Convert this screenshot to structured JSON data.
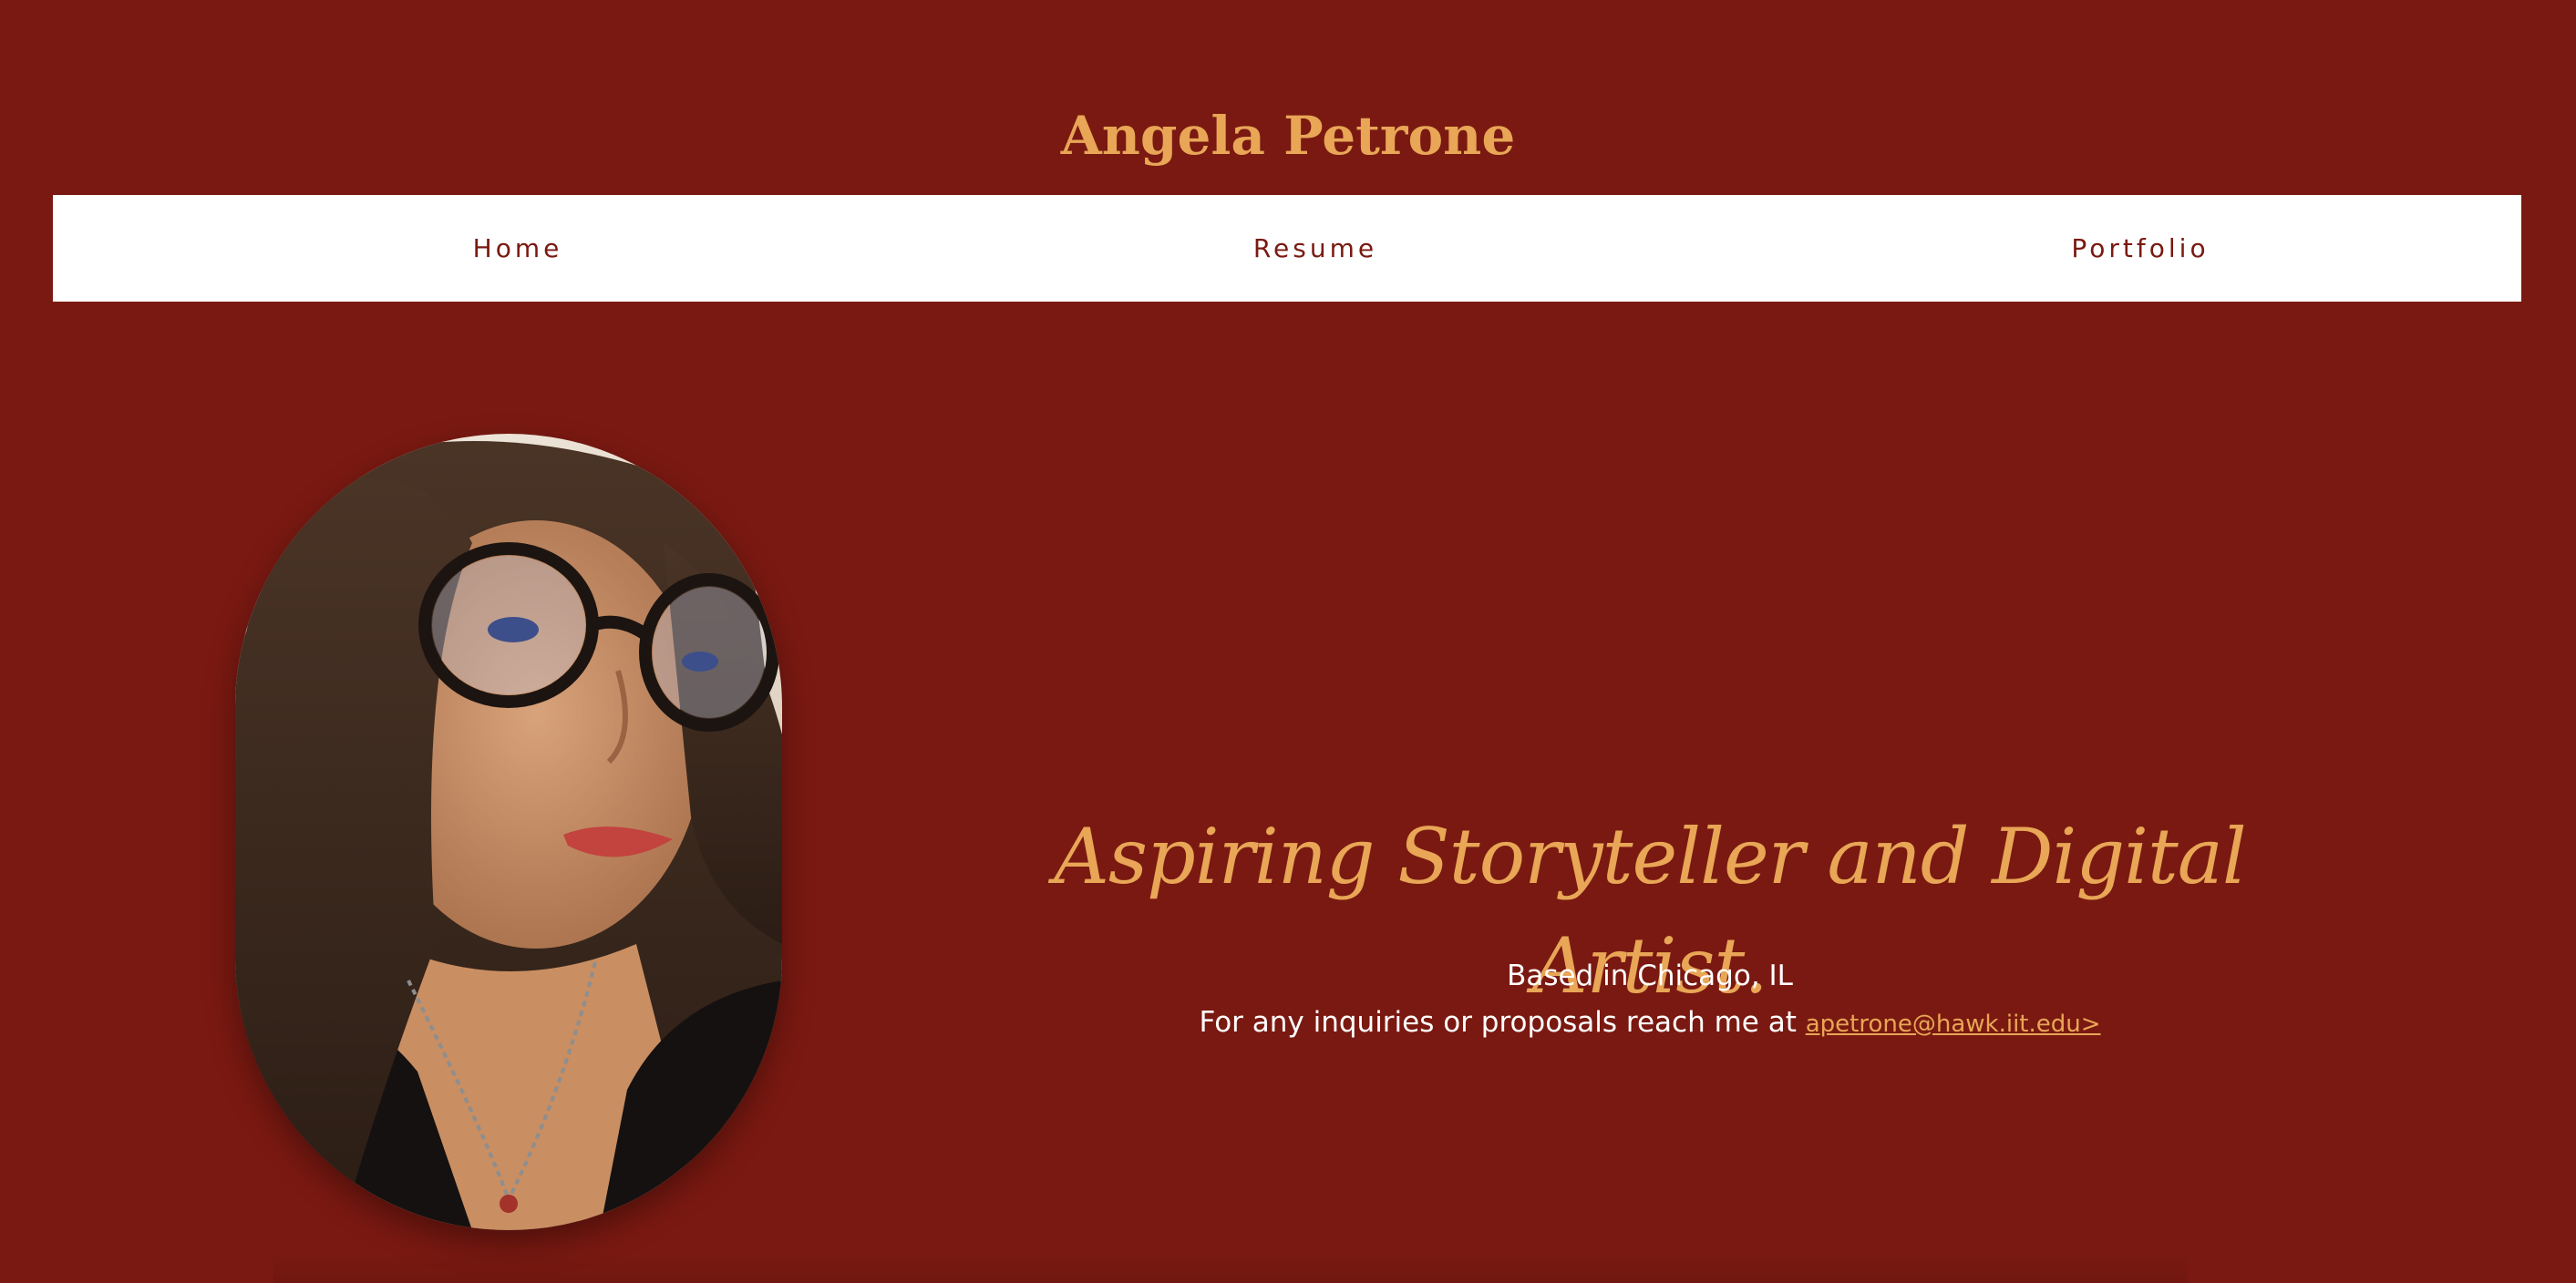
{
  "header": {
    "site_title": "Angela Petrone"
  },
  "nav": {
    "items": [
      {
        "label": "Home"
      },
      {
        "label": "Resume"
      },
      {
        "label": "Portfolio"
      }
    ]
  },
  "portrait": {
    "alt": "Portrait photo of Angela Petrone"
  },
  "hero": {
    "tagline": "Aspiring Storyteller and Digital Artist.",
    "location": "Based in Chicago, IL",
    "contact_prefix": "For any inquiries or proposals reach me at ",
    "email": "apetrone@hawk.iit.edu>"
  },
  "colors": {
    "background": "#7a1911",
    "accent": "#e8a656",
    "nav_background": "#ffffff",
    "body_text": "#ffffff"
  }
}
